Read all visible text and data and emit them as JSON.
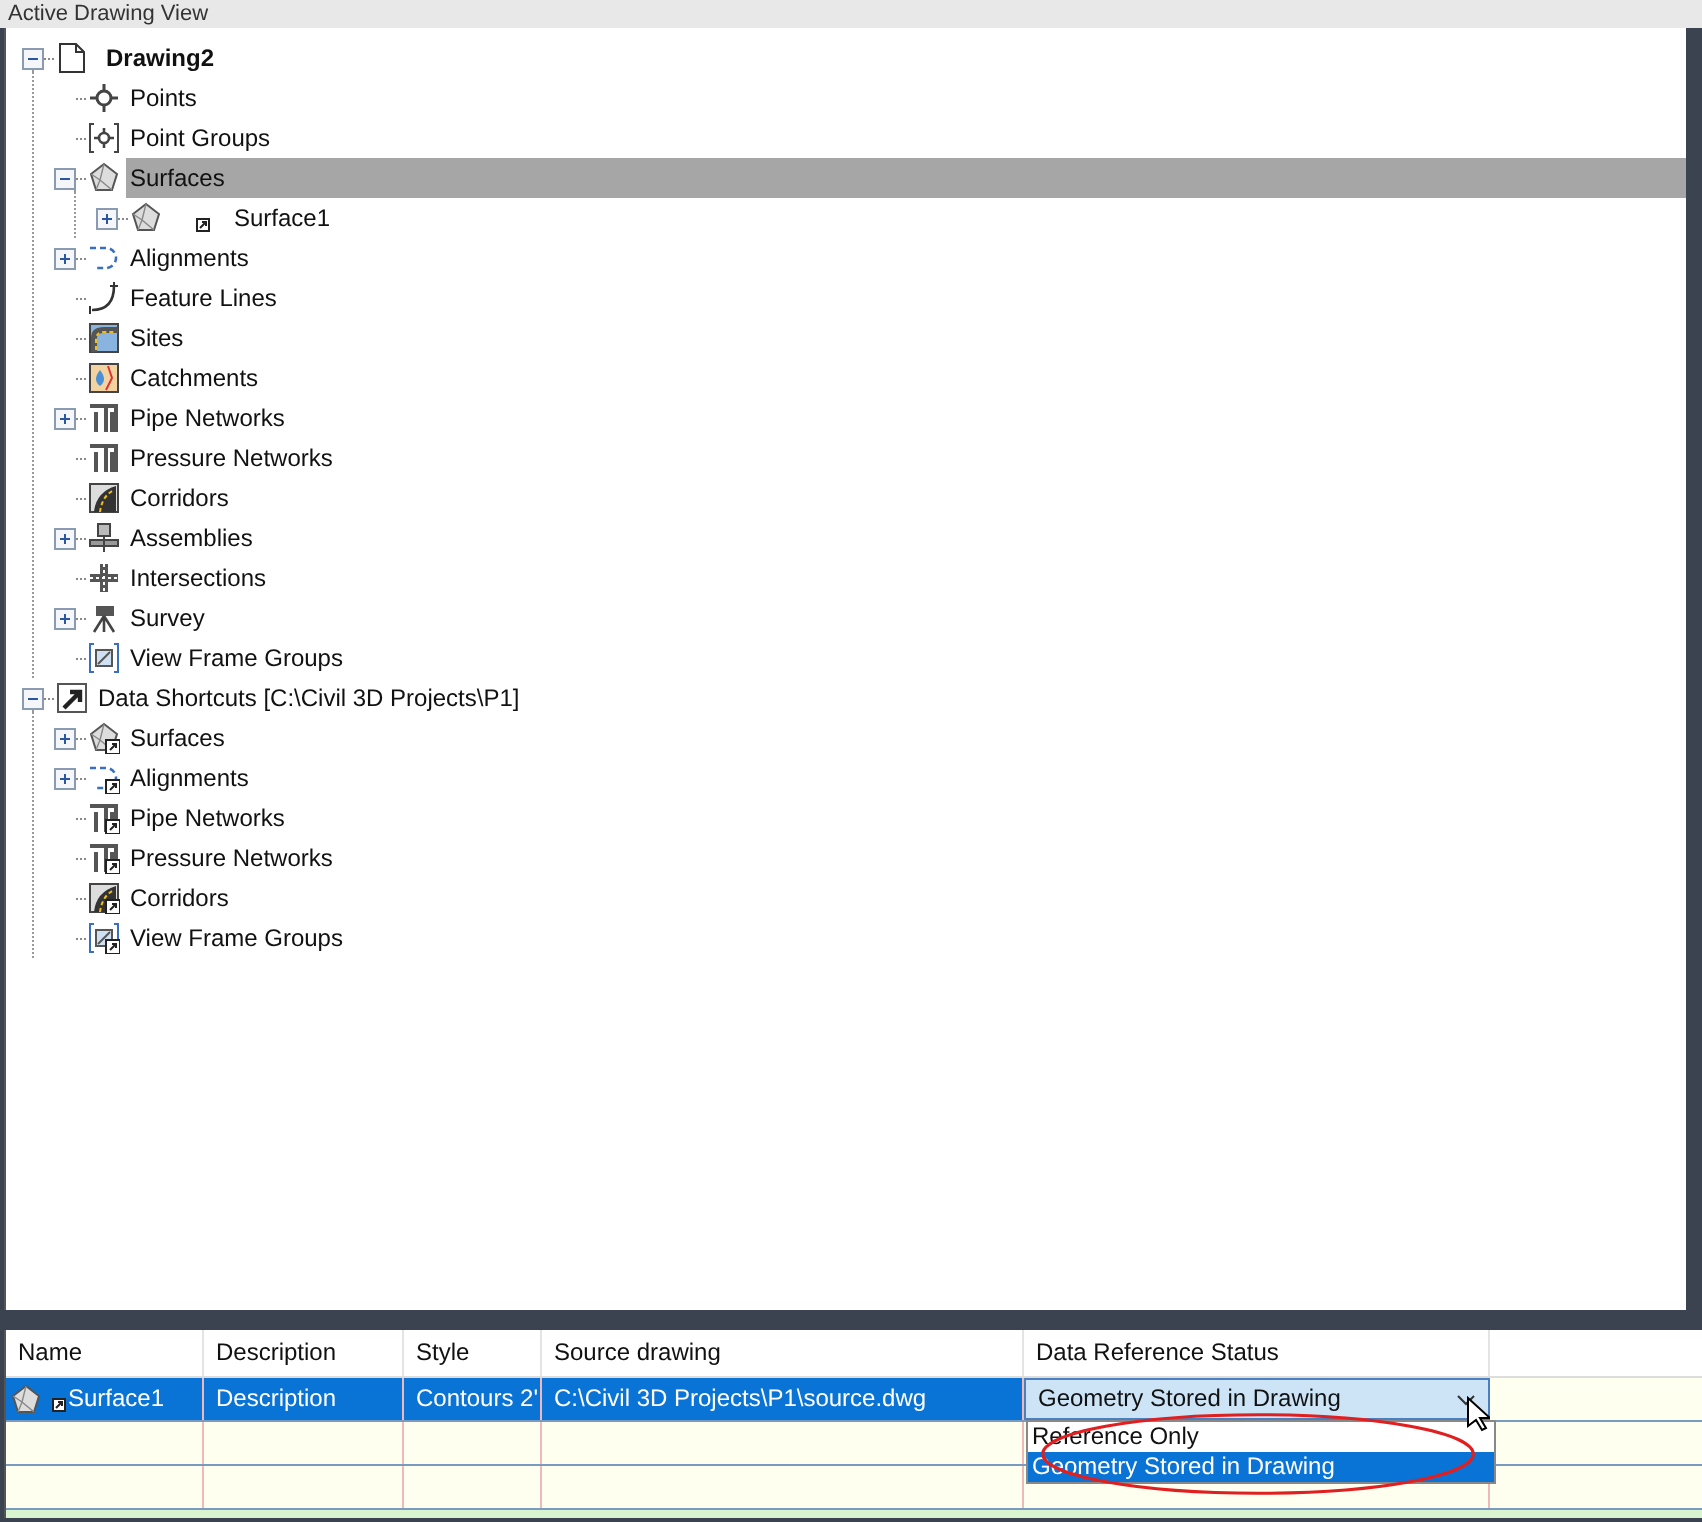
{
  "panel_title": "Active Drawing View",
  "tree": [
    {
      "label": "Drawing2",
      "kind": "drawing",
      "bold": true,
      "expandable": true,
      "expanded": true,
      "selected": false,
      "children": [
        {
          "label": "Points",
          "kind": "points",
          "expandable": false,
          "selected": false
        },
        {
          "label": "Point Groups",
          "kind": "pointgroups",
          "expandable": false,
          "selected": false
        },
        {
          "label": "Surfaces",
          "kind": "surface",
          "expandable": true,
          "expanded": true,
          "selected": true,
          "children": [
            {
              "label": "Surface1",
              "kind": "surface",
              "shortcut_badge": true,
              "expandable": true,
              "expanded": false,
              "selected": false
            }
          ]
        },
        {
          "label": "Alignments",
          "kind": "alignment",
          "expandable": true,
          "expanded": false,
          "selected": false
        },
        {
          "label": "Feature Lines",
          "kind": "featureline",
          "expandable": false,
          "selected": false
        },
        {
          "label": "Sites",
          "kind": "sites",
          "expandable": false,
          "selected": false
        },
        {
          "label": "Catchments",
          "kind": "catchment",
          "expandable": false,
          "selected": false
        },
        {
          "label": "Pipe Networks",
          "kind": "pipe",
          "expandable": true,
          "expanded": false,
          "selected": false
        },
        {
          "label": "Pressure Networks",
          "kind": "pipe",
          "expandable": false,
          "selected": false
        },
        {
          "label": "Corridors",
          "kind": "corridor",
          "expandable": false,
          "selected": false
        },
        {
          "label": "Assemblies",
          "kind": "assembly",
          "expandable": true,
          "expanded": false,
          "selected": false
        },
        {
          "label": "Intersections",
          "kind": "intersection",
          "expandable": false,
          "selected": false
        },
        {
          "label": "Survey",
          "kind": "survey",
          "expandable": true,
          "expanded": false,
          "selected": false
        },
        {
          "label": "View Frame Groups",
          "kind": "viewframe",
          "expandable": false,
          "selected": false
        }
      ]
    },
    {
      "label": "Data Shortcuts [C:\\Civil 3D Projects\\P1]",
      "kind": "shortcut",
      "bold": false,
      "expandable": true,
      "expanded": true,
      "selected": false,
      "children": [
        {
          "label": "Surfaces",
          "kind": "surface",
          "shortcut_overlay": true,
          "expandable": true,
          "expanded": false,
          "selected": false
        },
        {
          "label": "Alignments",
          "kind": "alignment",
          "shortcut_overlay": true,
          "expandable": true,
          "expanded": false,
          "selected": false
        },
        {
          "label": "Pipe Networks",
          "kind": "pipe",
          "shortcut_overlay": true,
          "expandable": false,
          "selected": false
        },
        {
          "label": "Pressure Networks",
          "kind": "pipe",
          "shortcut_overlay": true,
          "expandable": false,
          "selected": false
        },
        {
          "label": "Corridors",
          "kind": "corridor",
          "shortcut_overlay": true,
          "expandable": false,
          "selected": false
        },
        {
          "label": "View Frame Groups",
          "kind": "viewframe",
          "shortcut_overlay": true,
          "expandable": false,
          "selected": false
        }
      ]
    }
  ],
  "table": {
    "columns": [
      "Name",
      "Description",
      "Style",
      "Source drawing",
      "Data Reference Status"
    ],
    "rows": [
      {
        "selected": true,
        "kind": "surface",
        "name": "Surface1",
        "description": "Description",
        "style": "Contours 2'",
        "source_drawing": "C:\\Civil 3D Projects\\P1\\source.dwg",
        "status": "Geometry Stored in Drawing"
      }
    ],
    "status_dropdown": {
      "open": true,
      "options": [
        {
          "label": "Reference Only",
          "selected": false
        },
        {
          "label": "Geometry Stored in Drawing",
          "selected": true
        }
      ]
    }
  }
}
